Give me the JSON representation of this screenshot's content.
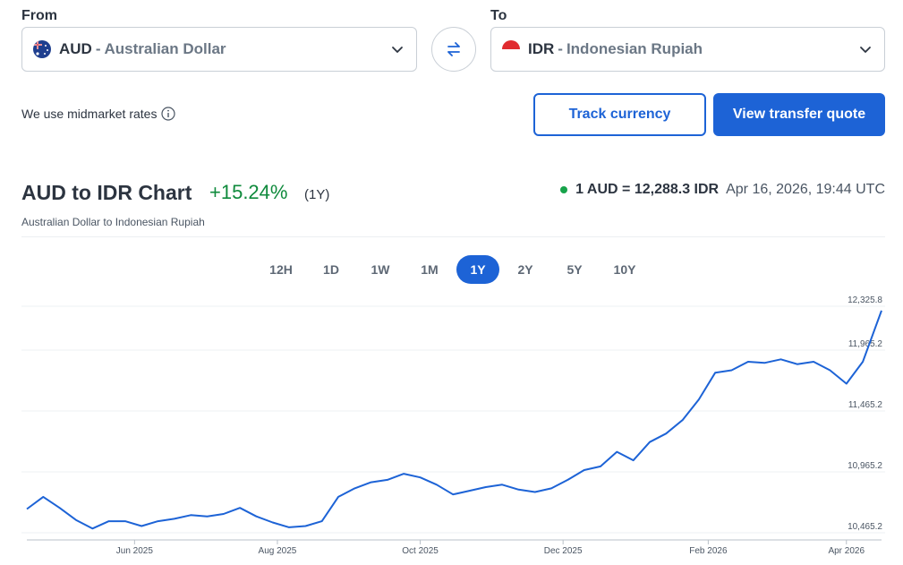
{
  "from": {
    "label": "From",
    "code": "AUD",
    "separator": "-",
    "name": "Australian Dollar"
  },
  "to": {
    "label": "To",
    "code": "IDR",
    "separator": "-",
    "name": "Indonesian Rupiah"
  },
  "midmarket_note": "We use midmarket rates",
  "buttons": {
    "track": "Track currency",
    "quote": "View transfer quote"
  },
  "chart_header": {
    "title": "AUD to IDR Chart",
    "change": "+15.24%",
    "period": "(1Y)",
    "subtitle": "Australian Dollar to Indonesian Rupiah",
    "rate": "1 AUD = 12,288.3 IDR",
    "timestamp": "Apr 16, 2026, 19:44 UTC",
    "status_color": "#17a34a"
  },
  "tabs": [
    "12H",
    "1D",
    "1W",
    "1M",
    "1Y",
    "2Y",
    "5Y",
    "10Y"
  ],
  "active_tab": "1Y",
  "colors": {
    "accent": "#1d63d6",
    "positive": "#0f8a3c",
    "line": "#1d63d6"
  },
  "chart_data": {
    "type": "line",
    "x_ticks": [
      "Jun 2025",
      "Aug 2025",
      "Oct 2025",
      "Dec 2025",
      "Feb 2026",
      "Apr 2026"
    ],
    "y_ticks": [
      "12,325.8",
      "11,965.2",
      "11,465.2",
      "10,965.2",
      "10,465.2"
    ],
    "y_tick_values": [
      12325.8,
      11965.2,
      11465.2,
      10965.2,
      10465.2
    ],
    "ylim": [
      10465.2,
      12325.8
    ],
    "grid": true,
    "series": [
      {
        "x": [
          "2025-04-16",
          "2025-04-23",
          "2025-04-30",
          "2025-05-07",
          "2025-05-14",
          "2025-05-21",
          "2025-05-28",
          "2025-06-04",
          "2025-06-11",
          "2025-06-18",
          "2025-06-25",
          "2025-07-02",
          "2025-07-09",
          "2025-07-16",
          "2025-07-23",
          "2025-07-30",
          "2025-08-06",
          "2025-08-13",
          "2025-08-20",
          "2025-08-27",
          "2025-09-03",
          "2025-09-10",
          "2025-09-17",
          "2025-09-24",
          "2025-10-01",
          "2025-10-08",
          "2025-10-15",
          "2025-10-22",
          "2025-10-29",
          "2025-11-05",
          "2025-11-12",
          "2025-11-19",
          "2025-11-26",
          "2025-12-03",
          "2025-12-10",
          "2025-12-17",
          "2025-12-24",
          "2025-12-31",
          "2026-01-07",
          "2026-01-14",
          "2026-01-21",
          "2026-01-28",
          "2026-02-04",
          "2026-02-11",
          "2026-02-18",
          "2026-02-25",
          "2026-03-04",
          "2026-03-11",
          "2026-03-18",
          "2026-03-25",
          "2026-04-01",
          "2026-04-08",
          "2026-04-16"
        ],
        "values": [
          10660,
          10760,
          10670,
          10570,
          10500,
          10560,
          10560,
          10520,
          10560,
          10580,
          10610,
          10600,
          10620,
          10670,
          10600,
          10550,
          10510,
          10520,
          10560,
          10760,
          10830,
          10880,
          10900,
          10950,
          10920,
          10860,
          10780,
          10810,
          10840,
          10860,
          10820,
          10800,
          10830,
          10900,
          10980,
          11010,
          11130,
          11060,
          11210,
          11280,
          11390,
          11560,
          11780,
          11800,
          11870,
          11860,
          11890,
          11850,
          11870,
          11800,
          11690,
          11870,
          12290
        ]
      }
    ]
  }
}
